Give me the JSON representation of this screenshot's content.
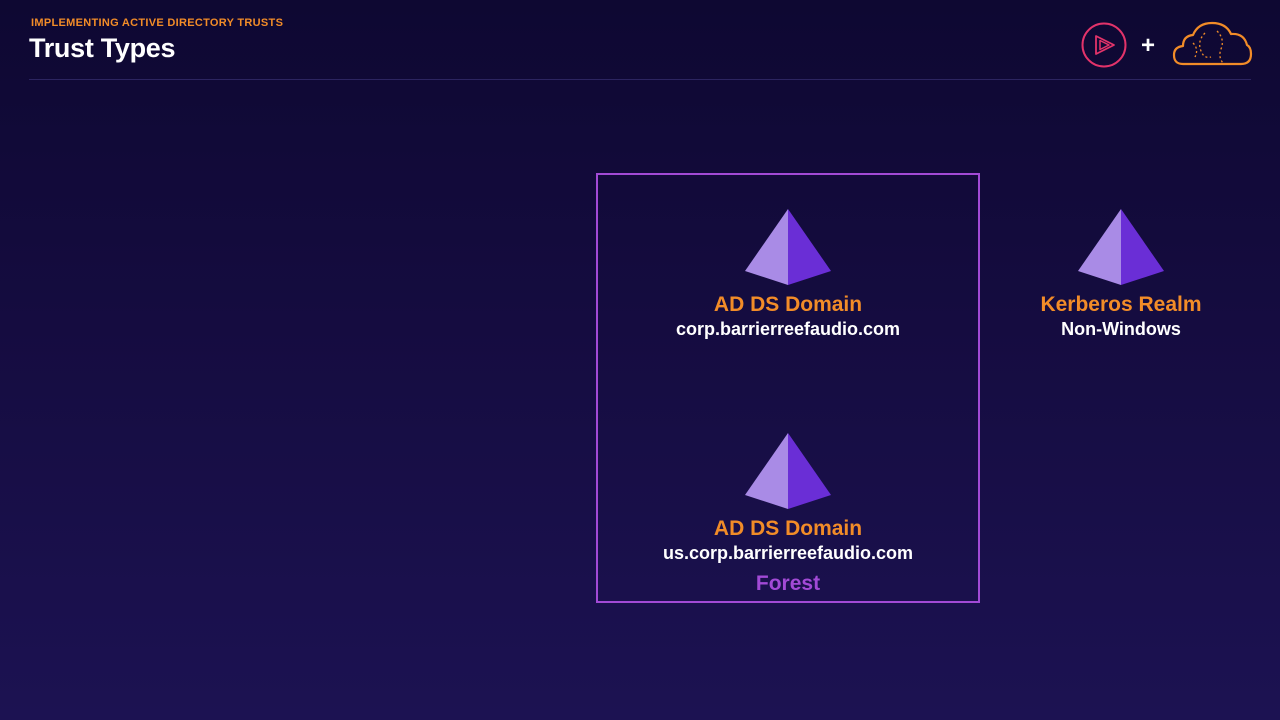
{
  "header": {
    "eyebrow": "IMPLEMENTING ACTIVE DIRECTORY TRUSTS",
    "title": "Trust Types",
    "plus": "+"
  },
  "diagram": {
    "forest_label": "Forest",
    "nodes": [
      {
        "title": "AD DS Domain",
        "subtitle": "corp.barrierreefaudio.com",
        "icon": "pyramid-icon"
      },
      {
        "title": "AD DS Domain",
        "subtitle": "us.corp.barrierreefaudio.com",
        "icon": "pyramid-icon"
      },
      {
        "title": "Kerberos Realm",
        "subtitle": "Non-Windows",
        "icon": "pyramid-icon"
      }
    ]
  },
  "colors": {
    "accent_orange": "#f28c28",
    "forest_purple": "#a24ad6",
    "pyramid_light": "#a98be6",
    "pyramid_dark": "#6a2ed6",
    "logo_red": "#e3336a"
  }
}
